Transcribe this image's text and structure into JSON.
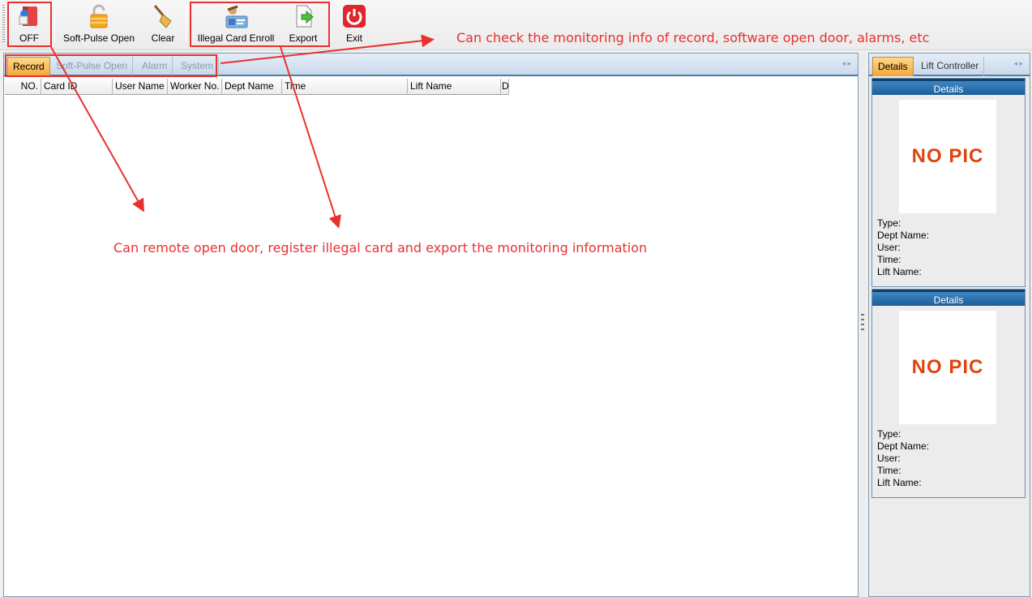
{
  "toolbar": {
    "off_label": "OFF",
    "soft_pulse_label": "Soft-Pulse Open",
    "clear_label": "Clear",
    "illegal_label": "Illegal Card Enroll",
    "export_label": "Export",
    "exit_label": "Exit"
  },
  "annotations": {
    "top": "Can check the monitoring info of record, software open door, alarms, etc",
    "middle": "Can remote open door, register illegal card and export the monitoring information"
  },
  "monitor_tabs": [
    "Record",
    "Soft-Pulse Open",
    "Alarm",
    "System"
  ],
  "grid_columns": [
    "NO.",
    "Card ID",
    "User Name",
    "Worker No.",
    "Dept Name",
    "Time",
    "Lift Name",
    "D"
  ],
  "right_tabs": [
    "Details",
    "Lift Controller"
  ],
  "details": [
    {
      "header": "Details",
      "pic": "NO PIC",
      "type": "Type:",
      "dept": "Dept Name:",
      "user": "User:",
      "time": "Time:",
      "lift": "Lift Name:"
    },
    {
      "header": "Details",
      "pic": "NO PIC",
      "type": "Type:",
      "dept": "Dept Name:",
      "user": "User:",
      "time": "Time:",
      "lift": "Lift Name:"
    }
  ],
  "colors": {
    "annotation": "#e8312f",
    "tab_active": "#f2a53a",
    "header_blue": "#1a5e9a",
    "no_pic": "#e0440e"
  },
  "icons": [
    "off-icon",
    "unlock-icon",
    "broom-icon",
    "illegal-card-icon",
    "export-icon",
    "power-icon"
  ]
}
